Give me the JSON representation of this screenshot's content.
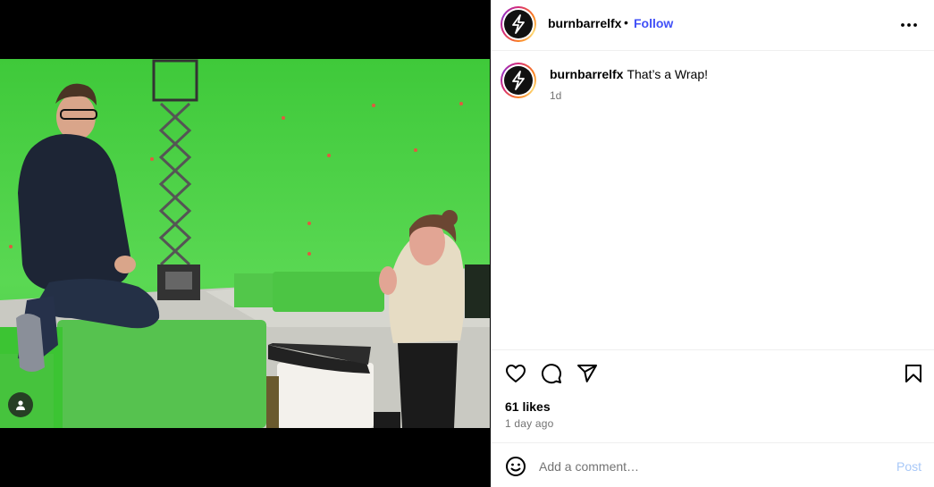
{
  "post": {
    "username": "burnbarrelfx",
    "follow_label": "Follow",
    "separator": "•",
    "caption": "That’s a Wrap!",
    "caption_age": "1d",
    "likes": "61 likes",
    "posted_ago": "1 day ago"
  },
  "comment": {
    "placeholder": "Add a comment…",
    "post_label": "Post"
  },
  "colors": {
    "follow": "#4150f7",
    "post_disabled": "#a8c8f8",
    "green_screen": "#4fd146"
  },
  "icons": {
    "header_more": "more-horizontal-icon",
    "like": "heart-icon",
    "comment": "comment-icon",
    "share": "paper-plane-icon",
    "save": "bookmark-icon",
    "emoji": "smiley-icon",
    "tagged_user": "user-icon",
    "avatar": "lightning-bolt-logo"
  }
}
